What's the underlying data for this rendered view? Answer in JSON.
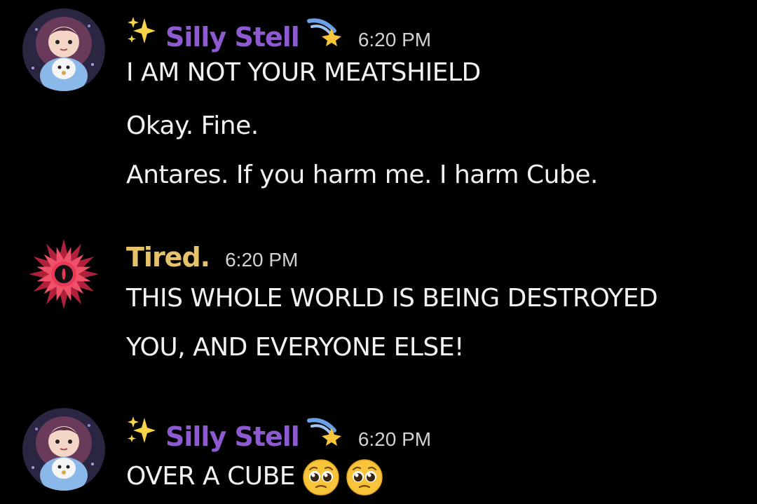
{
  "colors": {
    "background": "#000000",
    "silly_stell_name": "#8e5ad1",
    "tired_name": "#e6c36a",
    "timestamp": "#d2d2d6",
    "message_text": "#f2f2f4"
  },
  "messages": [
    {
      "author": "Silly Stell",
      "author_prefix_icon": "sparkles-icon",
      "author_suffix_icon": "shooting-star-icon",
      "timestamp": "6:20 PM",
      "avatar_icon": "girl-with-ghost-avatar",
      "lines": [
        "I AM NOT YOUR MEATSHIELD",
        "Okay. Fine.",
        "Antares. If you harm me. I harm Cube."
      ]
    },
    {
      "author": "Tired.",
      "timestamp": "6:20 PM",
      "avatar_icon": "red-eye-flower-avatar",
      "lines": [
        "THIS WHOLE WORLD IS BEING DESTROYED",
        "YOU, AND EVERYONE ELSE!"
      ]
    },
    {
      "author": "Silly Stell",
      "author_prefix_icon": "sparkles-icon",
      "author_suffix_icon": "shooting-star-icon",
      "timestamp": "6:20 PM",
      "avatar_icon": "girl-with-ghost-avatar",
      "lines": [
        "OVER A CUBE"
      ],
      "trailing_emojis": [
        "pleading-face-icon",
        "pleading-face-icon"
      ]
    }
  ]
}
